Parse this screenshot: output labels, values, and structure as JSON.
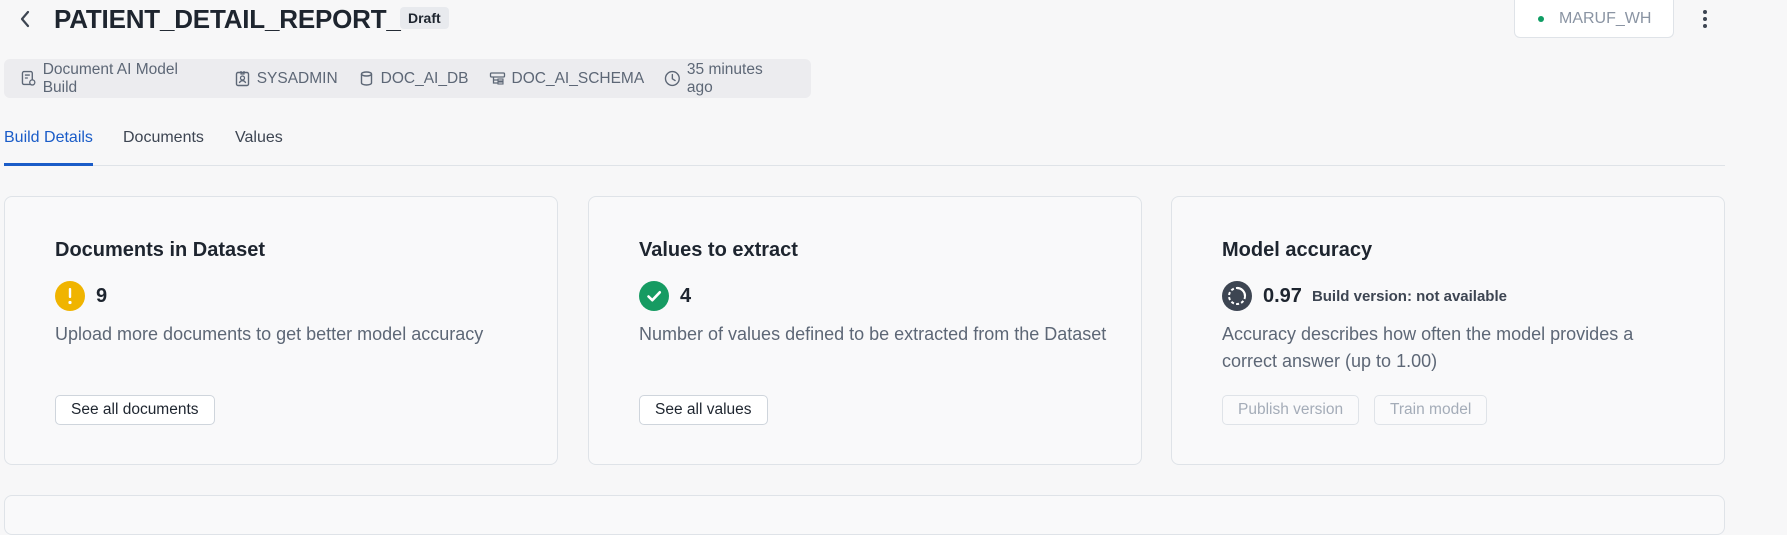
{
  "header": {
    "title": "PATIENT_DETAIL_REPORT_1",
    "status_badge": "Draft",
    "warehouse": "MARUF_WH"
  },
  "meta": {
    "items": [
      {
        "icon": "document-build-icon",
        "label": "Document AI Model Build"
      },
      {
        "icon": "user-badge-icon",
        "label": "SYSADMIN"
      },
      {
        "icon": "database-icon",
        "label": "DOC_AI_DB"
      },
      {
        "icon": "schema-icon",
        "label": "DOC_AI_SCHEMA"
      },
      {
        "icon": "clock-icon",
        "label": "35 minutes ago"
      }
    ]
  },
  "tabs": [
    {
      "label": "Build Details",
      "active": true
    },
    {
      "label": "Documents",
      "active": false
    },
    {
      "label": "Values",
      "active": false
    }
  ],
  "cards": {
    "documents": {
      "title": "Documents in Dataset",
      "status_icon": "warning-icon",
      "value": "9",
      "description": "Upload more documents to get better model accuracy",
      "button": "See all documents"
    },
    "values": {
      "title": "Values to extract",
      "status_icon": "check-circle-icon",
      "value": "4",
      "description": "Number of values defined to be extracted from the Dataset",
      "button": "See all values"
    },
    "accuracy": {
      "title": "Model accuracy",
      "status_icon": "progress-ring-icon",
      "value": "0.97",
      "build_version": "Build version: not available",
      "description": "Accuracy describes how often the model provides a correct answer (up to 1.00)",
      "publish_button": "Publish version",
      "train_button": "Train model"
    }
  },
  "colors": {
    "accent": "#1a5cc8",
    "warning": "#f0b400",
    "success": "#169b62",
    "status_dot": "#0f9d64"
  }
}
